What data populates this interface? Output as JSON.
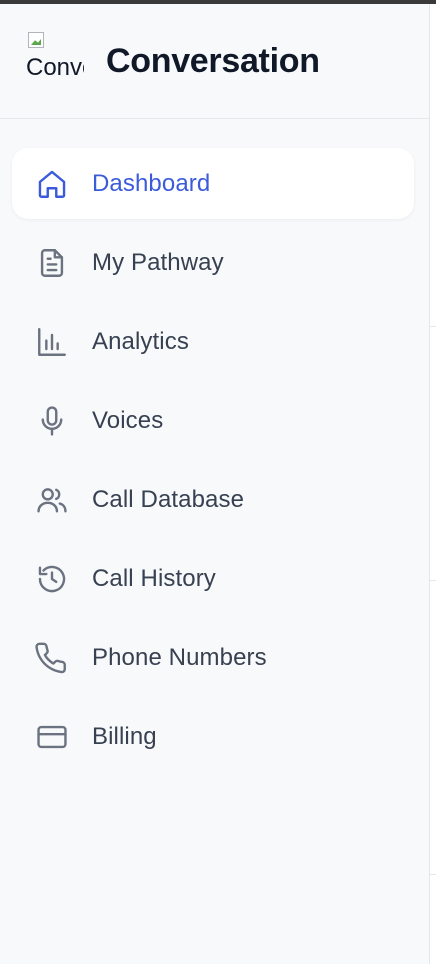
{
  "brand": {
    "logo_alt": "Conversation",
    "title": "Conversation"
  },
  "nav": {
    "items": [
      {
        "label": "Dashboard",
        "icon": "home-icon",
        "active": true
      },
      {
        "label": "My Pathway",
        "icon": "document-icon",
        "active": false
      },
      {
        "label": "Analytics",
        "icon": "bar-chart-icon",
        "active": false
      },
      {
        "label": "Voices",
        "icon": "microphone-icon",
        "active": false
      },
      {
        "label": "Call Database",
        "icon": "users-icon",
        "active": false
      },
      {
        "label": "Call History",
        "icon": "history-icon",
        "active": false
      },
      {
        "label": "Phone Numbers",
        "icon": "phone-icon",
        "active": false
      },
      {
        "label": "Billing",
        "icon": "credit-card-icon",
        "active": false
      }
    ]
  },
  "colors": {
    "accent": "#3b5bdb",
    "sidebar_bg": "#f8f9fb",
    "text": "#374151"
  }
}
